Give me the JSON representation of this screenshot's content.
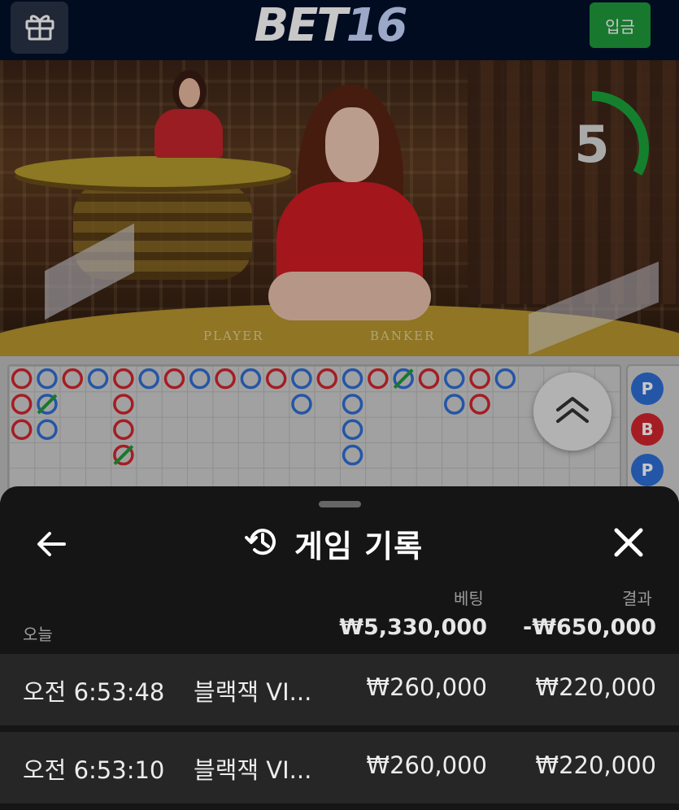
{
  "header": {
    "logo_part1": "BET",
    "logo_part2": "16",
    "deposit_label": "입금",
    "gift_icon": "gift-icon"
  },
  "video": {
    "felt_player": "PLAYER",
    "felt_banker": "BANKER",
    "countdown": "5",
    "countdown_fraction": 0.33,
    "countdown_color": "#1aa53a"
  },
  "road": {
    "colors": {
      "player": "#2f6fd6",
      "banker": "#d3262e",
      "tie": "#1e9a3c"
    },
    "big_road": [
      [
        "B",
        "B",
        "B"
      ],
      [
        "P",
        "T",
        "P"
      ],
      [
        "B"
      ],
      [
        "P"
      ],
      [
        "B",
        "B",
        "B",
        "T"
      ],
      [
        "P"
      ],
      [
        "B"
      ],
      [
        "P"
      ],
      [
        "B"
      ],
      [
        "P"
      ],
      [
        "B"
      ],
      [
        "P",
        "P"
      ],
      [
        "B"
      ],
      [
        "P",
        "P",
        "P",
        "P"
      ],
      [
        "B"
      ],
      [
        "T"
      ],
      [
        "B"
      ],
      [
        "P",
        "P"
      ],
      [
        "B",
        "B"
      ],
      [
        "P"
      ]
    ],
    "bead_side": [
      {
        "label": "P",
        "type": "player"
      },
      {
        "label": "B",
        "type": "banker"
      },
      {
        "label": "P",
        "type": "player"
      }
    ]
  },
  "sheet": {
    "title": "게임 기록",
    "bet_header": "베팅",
    "result_header": "결과",
    "today_label": "오늘",
    "total_bet": "₩5,330,000",
    "total_result": "-₩650,000",
    "rows": [
      {
        "time": "오전 6:53:48",
        "game": "블랙잭 VI...",
        "bet": "₩260,000",
        "result": "₩220,000"
      },
      {
        "time": "오전 6:53:10",
        "game": "블랙잭 VI...",
        "bet": "₩260,000",
        "result": "₩220,000"
      }
    ]
  }
}
